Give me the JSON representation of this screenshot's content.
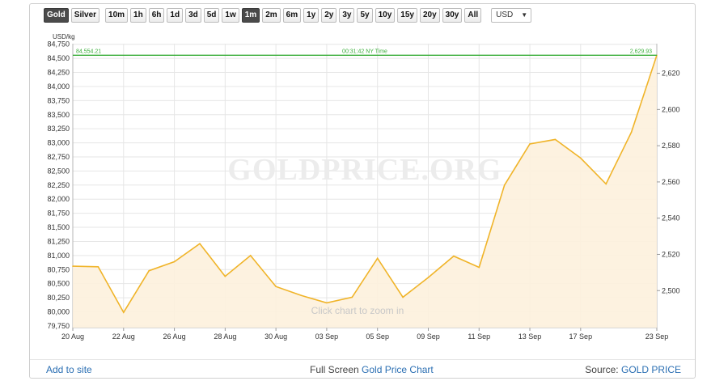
{
  "toolbar": {
    "metals": [
      "Gold",
      "Silver"
    ],
    "active_metal": "Gold",
    "ranges": [
      "10m",
      "1h",
      "6h",
      "1d",
      "3d",
      "5d",
      "1w",
      "1m",
      "2m",
      "6m",
      "1y",
      "2y",
      "3y",
      "5y",
      "10y",
      "15y",
      "20y",
      "30y",
      "All"
    ],
    "active_range": "1m",
    "currency": "USD"
  },
  "chart": {
    "unit_label": "USD/kg",
    "watermark": "GOLDPRICE.ORG",
    "zoom_hint": "Click chart to zoom in",
    "current_left": "84,554.21",
    "current_center": "00:31:42 NY Time",
    "current_right": "2,629.93",
    "colors": {
      "line": "#f0b429",
      "fill": "#fdf1dd",
      "current": "#3aae3a",
      "grid": "#e6e6e6"
    }
  },
  "chart_data": {
    "type": "area",
    "x": [
      "20 Aug",
      "21 Aug",
      "22 Aug",
      "23 Aug",
      "26 Aug",
      "27 Aug",
      "28 Aug",
      "29 Aug",
      "30 Aug",
      "02 Sep",
      "03 Sep",
      "04 Sep",
      "05 Sep",
      "06 Sep",
      "09 Sep",
      "10 Sep",
      "11 Sep",
      "12 Sep",
      "13 Sep",
      "16 Sep",
      "17 Sep",
      "18 Sep",
      "19 Sep",
      "23 Sep"
    ],
    "values": [
      80810,
      80800,
      79990,
      80730,
      80890,
      81210,
      80630,
      81000,
      80450,
      80290,
      80160,
      80260,
      80950,
      80260,
      80610,
      80990,
      80790,
      82250,
      82980,
      83060,
      82730,
      82270,
      83190,
      84554.21
    ],
    "x_tick_labels": [
      "20 Aug",
      "22 Aug",
      "26 Aug",
      "28 Aug",
      "30 Aug",
      "03 Sep",
      "05 Sep",
      "09 Sep",
      "11 Sep",
      "13 Sep",
      "17 Sep",
      "23 Sep"
    ],
    "y_left_ticks": [
      79750,
      80000,
      80250,
      80500,
      80750,
      81000,
      81250,
      81500,
      81750,
      82000,
      82250,
      82500,
      82750,
      83000,
      83250,
      83500,
      83750,
      84000,
      84250,
      84500,
      84750
    ],
    "y_left_unit": "USD/kg",
    "y_left_range": [
      79720,
      84760
    ],
    "y_right_ticks": [
      2500,
      2520,
      2540,
      2560,
      2580,
      2600,
      2620
    ],
    "current_value_kg": 84554.21,
    "current_value_oz": 2629.93,
    "grid": true
  },
  "footer": {
    "add_to_site": "Add to site",
    "full_screen_prefix": "Full Screen",
    "full_screen_link": "Gold Price Chart",
    "source_prefix": "Source:",
    "source_link": "GOLD PRICE"
  }
}
